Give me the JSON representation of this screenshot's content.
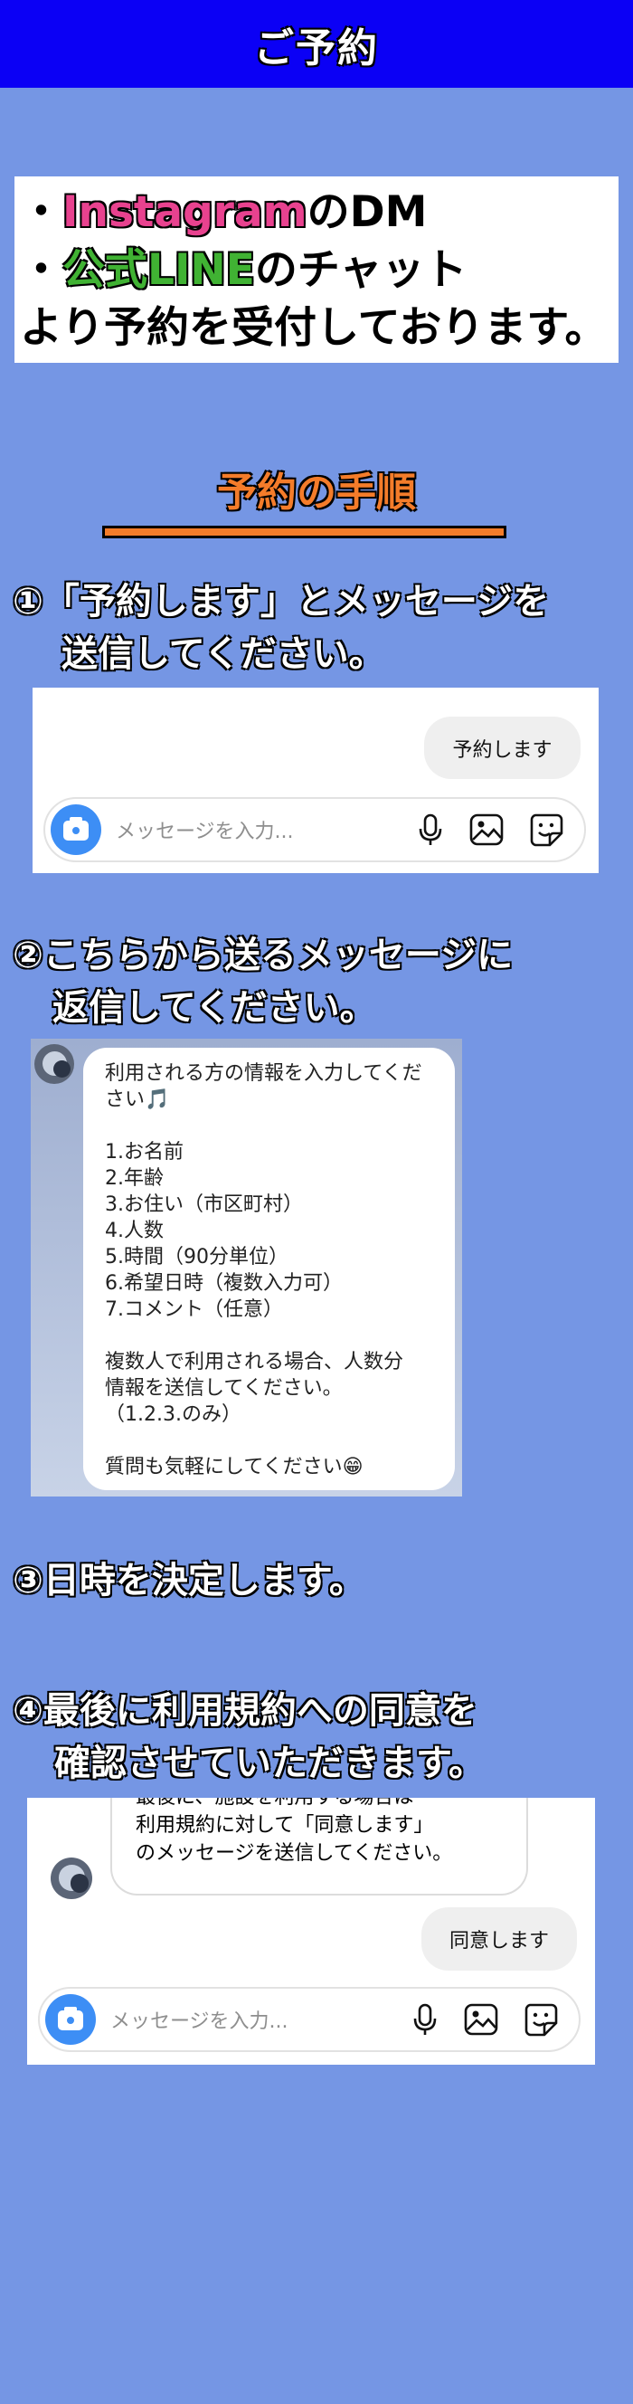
{
  "header": {
    "title": "ご予約"
  },
  "intro": {
    "bullet": "・",
    "instagram": "Instagram",
    "instagram_suffix": "のDM",
    "line": "公式LINE",
    "line_suffix": "のチャット",
    "closing": "より予約を受付しております。"
  },
  "procedure": {
    "title": "予約の手順"
  },
  "steps": [
    {
      "line1": "①「予約します」とメッセージを",
      "line2": "送信してください。"
    },
    {
      "line1": "②こちらから送るメッセージに",
      "line2": "返信してください。"
    },
    {
      "line1": "③日時を決定します。"
    },
    {
      "line1": "④最後に利用規約への同意を",
      "line2": "確認させていただきます。"
    }
  ],
  "composer": {
    "placeholder": "メッセージを入力..."
  },
  "chat1": {
    "sent": "予約します"
  },
  "chat2": {
    "lines": [
      "利用される方の情報を入力してくだ",
      "さい🎵",
      "",
      "1.お名前",
      "2.年齢",
      "3.お住い（市区町村）",
      "4.人数",
      "5.時間（90分単位）",
      "6.希望日時（複数入力可）",
      "7.コメント（任意）",
      "",
      "複数人で利用される場合、人数分",
      "情報を送信してください。",
      "（1.2.3.のみ）",
      "",
      "質問も気軽にしてください😁"
    ]
  },
  "chat4": {
    "received_lines": [
      "最後に、施設を利用する場合は",
      "利用規約に対して「同意します」",
      "のメッセージを送信してください。"
    ],
    "sent": "同意します"
  },
  "colors": {
    "background": "#7596e4",
    "header": "#0b00f5",
    "instagram": "#e8428f",
    "line": "#40b233",
    "procedure": "#f47c2a",
    "camera_button": "#3d8ef5"
  }
}
